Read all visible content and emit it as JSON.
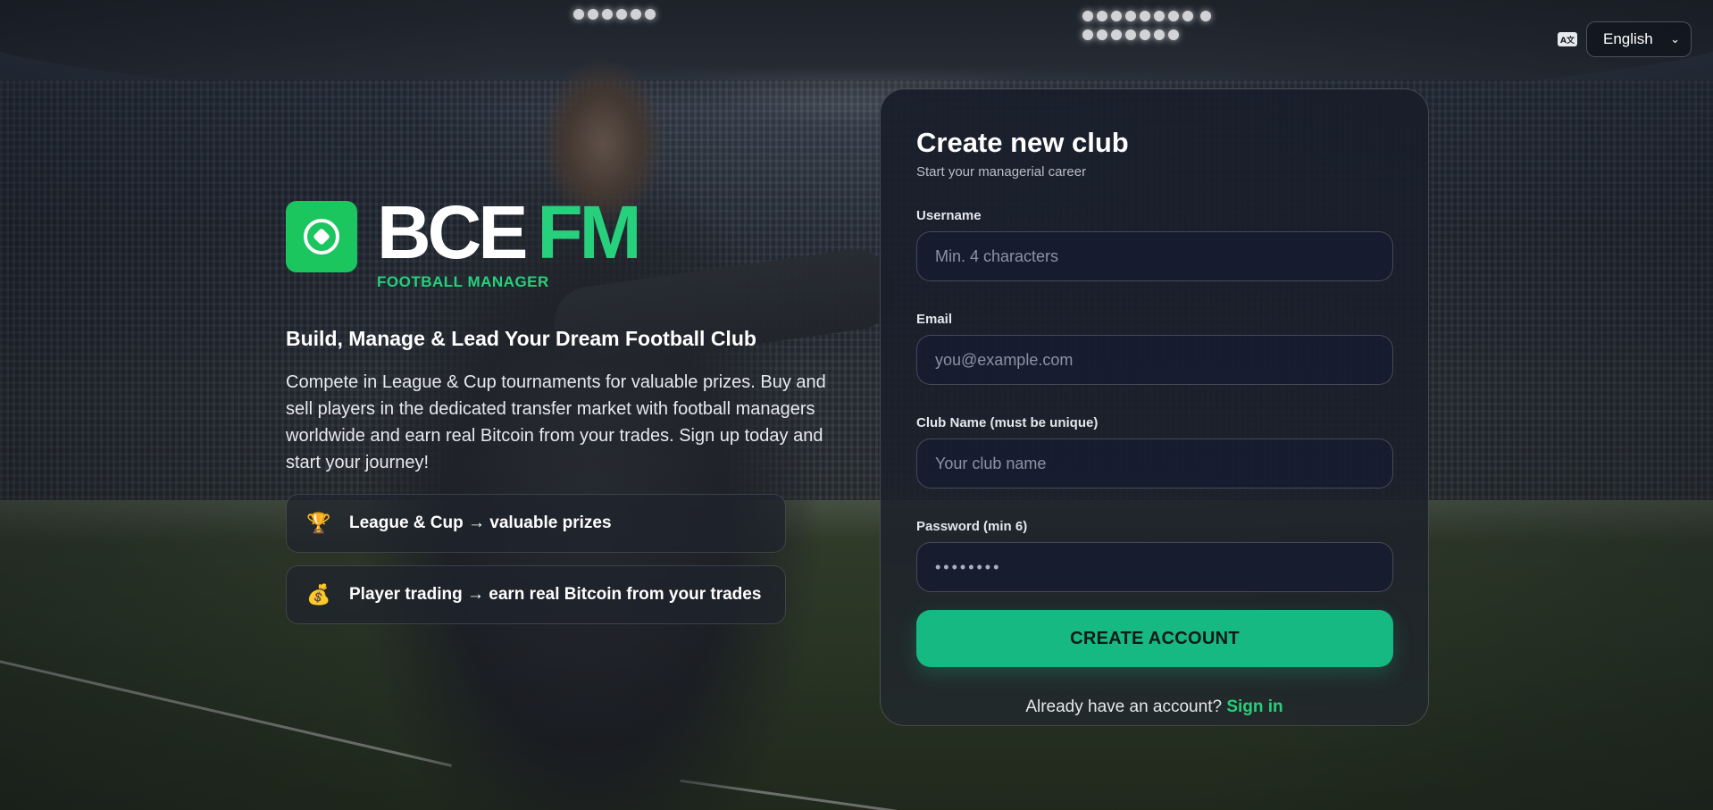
{
  "language": {
    "selected": "English",
    "icon": "translate-icon"
  },
  "brand": {
    "name_part1": "BCE",
    "name_part2": "FM",
    "tagline": "FOOTBALL MANAGER",
    "logo_icon": "soccer-ball-icon",
    "accent": "#26d07c"
  },
  "hero": {
    "headline": "Build, Manage & Lead Your Dream Football Club",
    "description": "Compete in League & Cup tournaments for valuable prizes. Buy and sell players in the dedicated transfer market with football managers worldwide and earn real Bitcoin from your trades. Sign up today and start your journey!",
    "features": [
      {
        "icon": "trophy-icon",
        "glyph": "🏆",
        "text": "League & Cup → valuable prizes"
      },
      {
        "icon": "money-bag-icon",
        "glyph": "💰",
        "text": "Player trading → earn real Bitcoin from your trades"
      }
    ]
  },
  "form": {
    "title": "Create new club",
    "subtitle": "Start your managerial career",
    "username": {
      "label": "Username",
      "placeholder": "Min. 4 characters",
      "value": ""
    },
    "email": {
      "label": "Email",
      "placeholder": "you@example.com",
      "value": ""
    },
    "club": {
      "label": "Club Name (must be unique)",
      "placeholder": "Your club name",
      "value": ""
    },
    "password": {
      "label": "Password (min 6)",
      "placeholder": "••••••••",
      "value": ""
    },
    "submit_label": "CREATE ACCOUNT",
    "signin_prompt": "Already have an account?",
    "signin_link": "Sign in",
    "button_color": "#16b981"
  }
}
